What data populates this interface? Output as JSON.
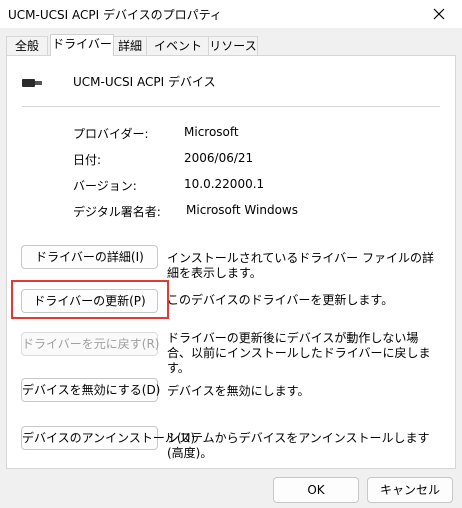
{
  "window": {
    "title": "UCM-UCSI ACPI デバイスのプロパティ"
  },
  "tabs": [
    "全般",
    "ドライバー",
    "詳細",
    "イベント",
    "リソース"
  ],
  "device": {
    "name": "UCM-UCSI ACPI デバイス"
  },
  "info": {
    "provider_label": "プロバイダー:",
    "provider_value": "Microsoft",
    "date_label": "日付:",
    "date_value": "2006/06/21",
    "version_label": "バージョン:",
    "version_value": "10.0.22000.1",
    "signer_label": "デジタル署名者:",
    "signer_value": "Microsoft Windows"
  },
  "actions": [
    {
      "label": "ドライバーの詳細(I)",
      "description": "インストールされているドライバー ファイルの詳細を表示します。"
    },
    {
      "label": "ドライバーの更新(P)",
      "description": "このデバイスのドライバーを更新します。"
    },
    {
      "label": "ドライバーを元に戻す(R)",
      "description": "ドライバーの更新後にデバイスが動作しない場合、以前にインストールしたドライバーに戻します。"
    },
    {
      "label": "デバイスを無効にする(D)",
      "description": "デバイスを無効にします。"
    },
    {
      "label": "デバイスのアンインストール(U)",
      "description": "システムからデバイスをアンインストールします (高度)。"
    }
  ],
  "footer": {
    "ok": "OK",
    "cancel": "キャンセル"
  },
  "colors": {
    "highlight": "#e53935"
  }
}
